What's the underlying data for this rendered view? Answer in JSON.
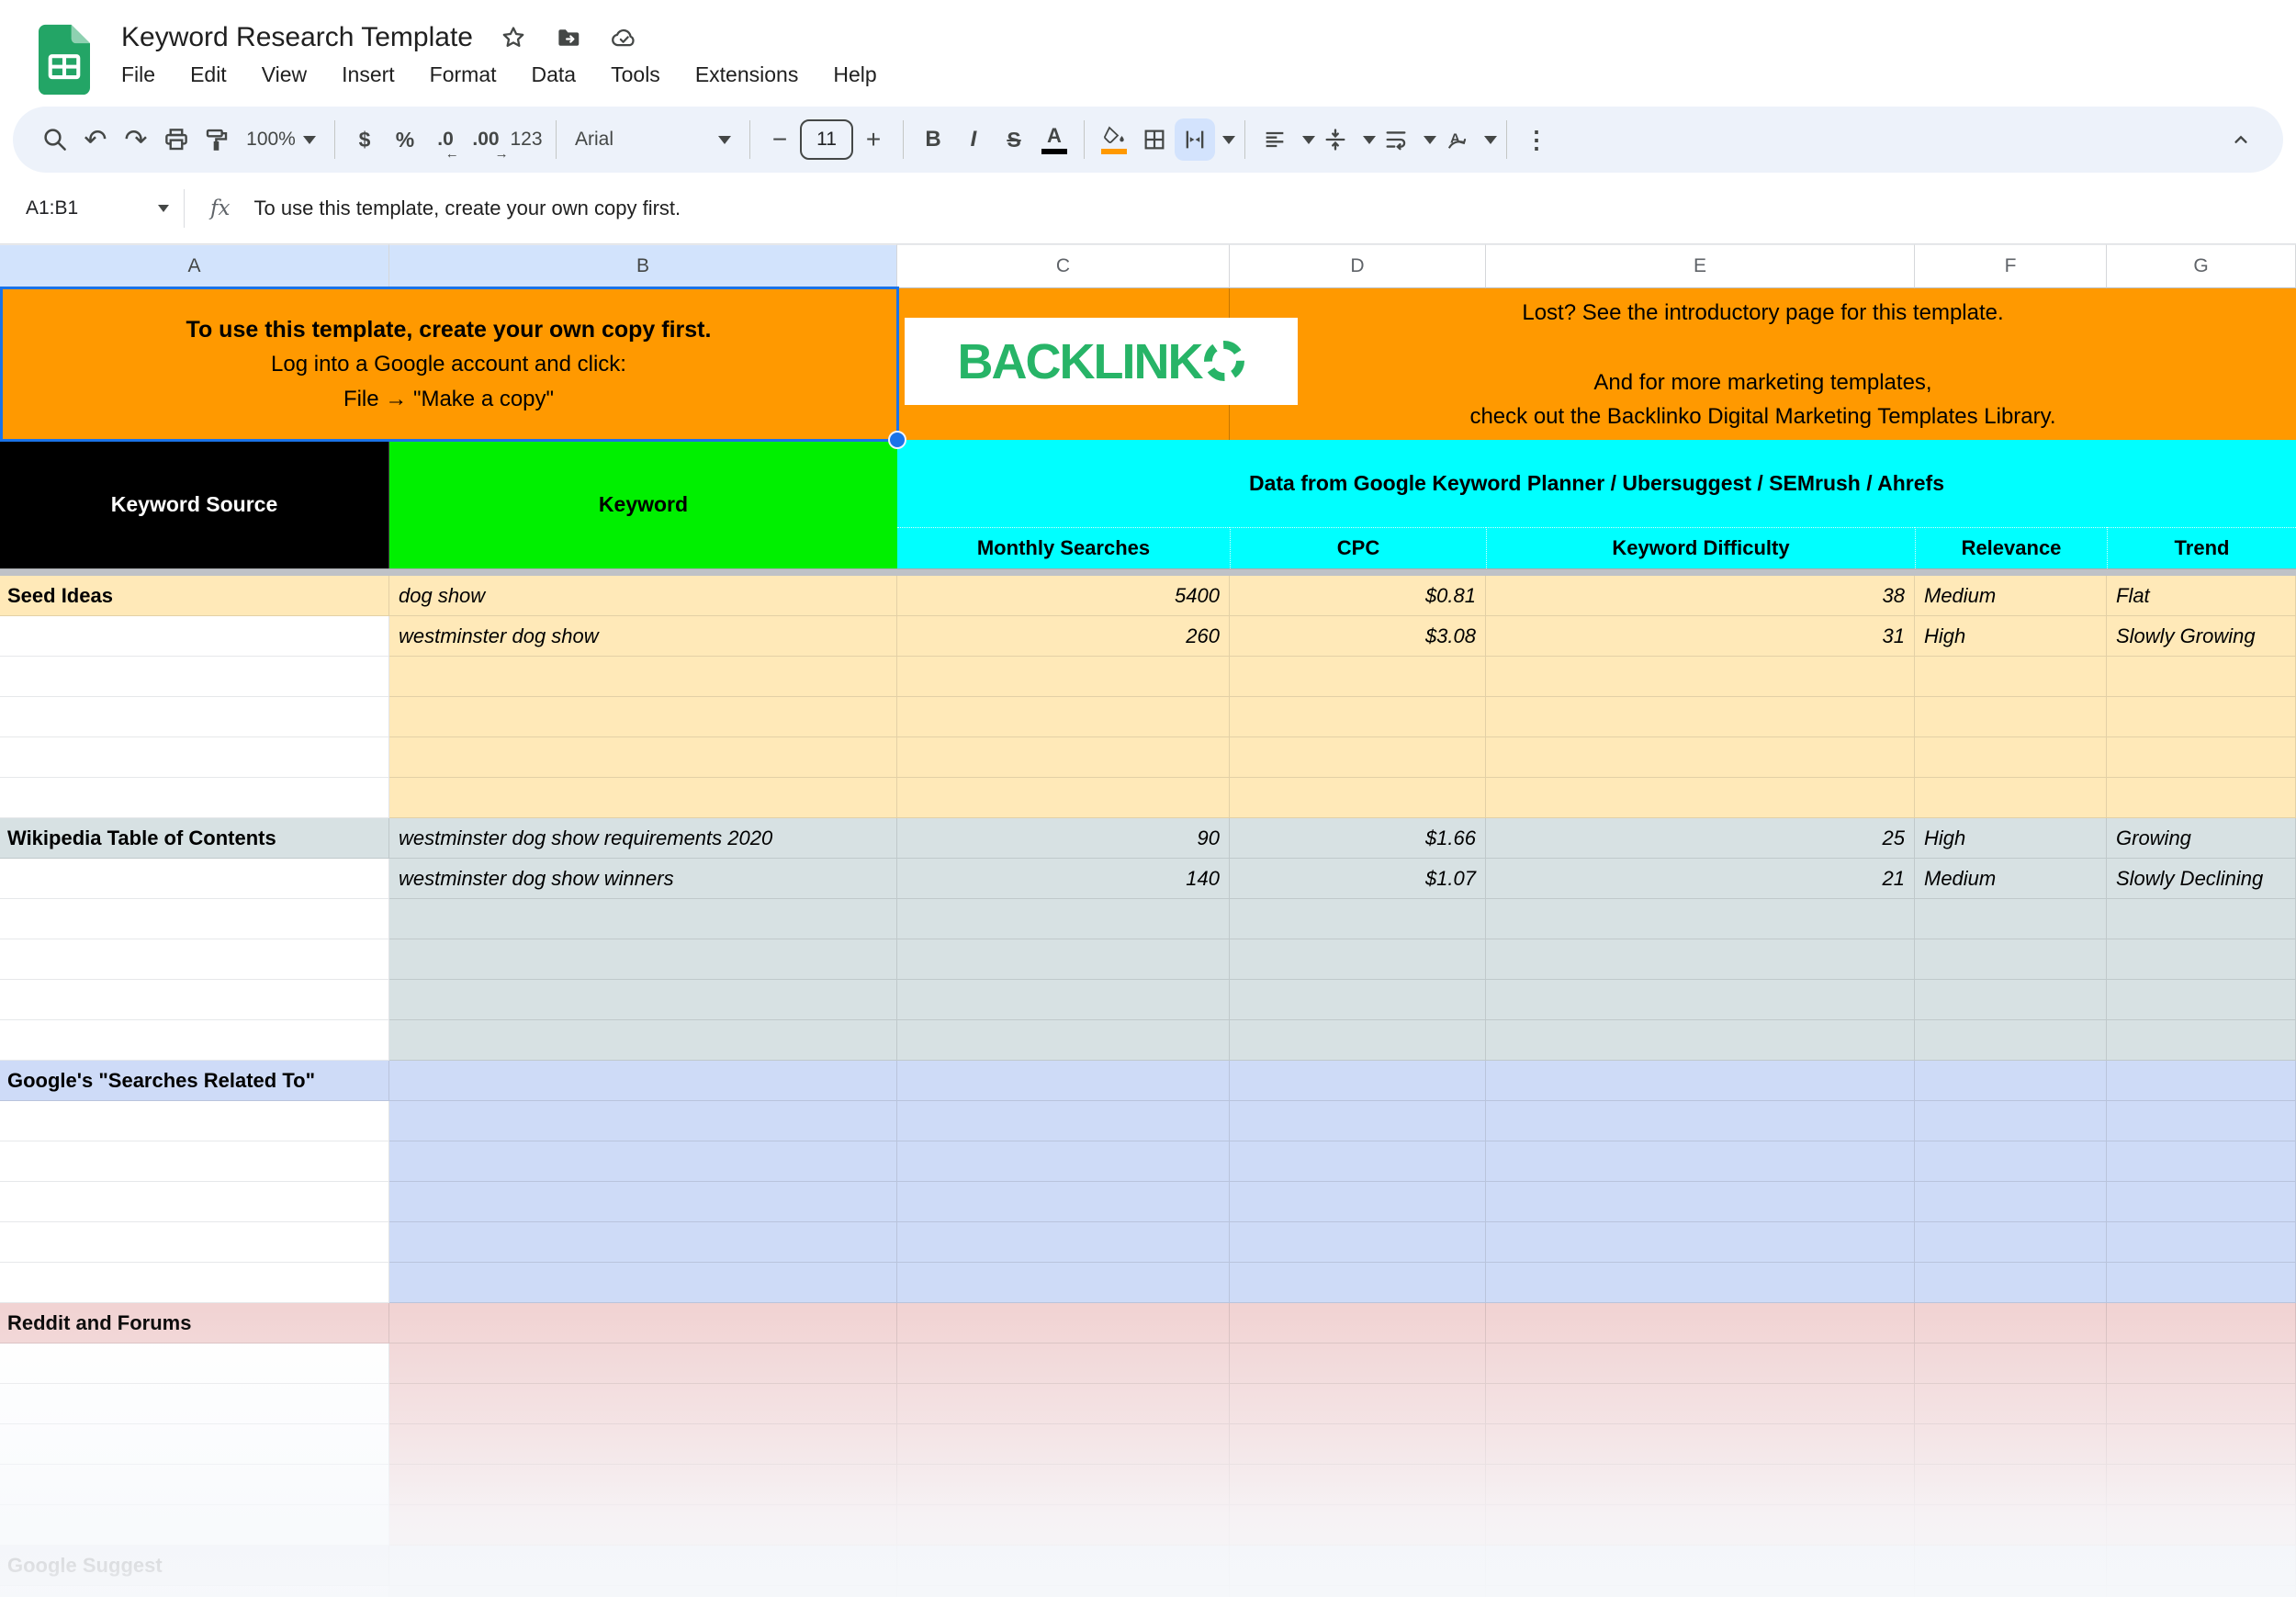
{
  "titlebar": {
    "title": "Keyword Research Template",
    "menus": [
      "File",
      "Edit",
      "View",
      "Insert",
      "Format",
      "Data",
      "Tools",
      "Extensions",
      "Help"
    ]
  },
  "toolbar": {
    "zoom": "100%",
    "currency": "$",
    "percent": "%",
    "decrease_decimals": ".0",
    "increase_decimals": ".00",
    "number_format": "123",
    "font": "Arial",
    "font_size": "11",
    "minus": "−",
    "plus": "+",
    "bold_label": "B",
    "italic_label": "I",
    "strike_label": "S",
    "text_color_label": "A",
    "more_label": "⋮",
    "icons": {
      "search": "magnifier",
      "undo": "↶",
      "redo": "↷",
      "print": "printer",
      "paint_format": "paint-roller",
      "fill_color": "paint-bucket with orange underline",
      "borders": "grid",
      "merge_cells": "inward arrows (active)",
      "horizontal_align": "align-left lines",
      "vertical_align": "arrows to center line",
      "text_wrap": "wrap arrow",
      "text_rotation": "A with arc arrow",
      "hide_menus": "chevron-up"
    },
    "accent_underline_text_color": "#000000",
    "accent_underline_fill_color": "#ff9900",
    "merge_active_bg": "#d3e3fd"
  },
  "formula_bar": {
    "range": "A1:B1",
    "fx_label": "fx",
    "value": "To use this template, create your own copy first."
  },
  "columns": {
    "letters": [
      "A",
      "B",
      "C",
      "D",
      "E",
      "F",
      "G"
    ],
    "selected": [
      "A",
      "B"
    ]
  },
  "banner": {
    "bg": "#ff9900",
    "ab": {
      "line1": "To use this template, create your own copy first.",
      "line2": "Log into a Google account and click:",
      "line3": "File → \"Make a copy\""
    },
    "logo": {
      "text": "BACKLINK",
      "o": "dashed-circle-O",
      "color": "#27b467"
    },
    "right": {
      "line1": "Lost? See the introductory page for this template.",
      "line2": "And for more marketing templates,",
      "line3": "check out the Backlinko Digital Marketing Templates Library."
    }
  },
  "table": {
    "source_header": "Keyword Source",
    "keyword_header": "Keyword",
    "data_header": "Data from Google Keyword Planner / Ubersuggest / SEMrush / Ahrefs",
    "subheaders": [
      "Monthly Searches",
      "CPC",
      "Keyword Difficulty",
      "Relevance",
      "Trend"
    ],
    "header_colors": {
      "source_bg": "#000000",
      "keyword_bg": "#00f000",
      "data_bg": "#00ffff"
    },
    "fills": {
      "seed": "#ffe9b8",
      "wiki": "#d7e1e3",
      "related": "#cedbf7",
      "reddit": "#f1d3d3",
      "suggest": "#e6e8ee"
    },
    "rows": [
      {
        "sec": "seed",
        "a": "Seed Ideas",
        "aFill": true,
        "b": "dog show",
        "c": "5400",
        "d": "$0.81",
        "e": "38",
        "f": "Medium",
        "g": "Flat"
      },
      {
        "sec": "seed",
        "b": "westminster dog show",
        "c": "260",
        "d": "$3.08",
        "e": "31",
        "f": "High",
        "g": "Slowly Growing"
      },
      {
        "sec": "seed"
      },
      {
        "sec": "seed"
      },
      {
        "sec": "seed"
      },
      {
        "sec": "seed"
      },
      {
        "sec": "wiki",
        "a": "Wikipedia Table of Contents",
        "aFill": true,
        "b": "westminster dog show requirements 2020",
        "c": "90",
        "d": "$1.66",
        "e": "25",
        "f": "High",
        "g": "Growing"
      },
      {
        "sec": "wiki",
        "b": "westminster dog show winners",
        "c": "140",
        "d": "$1.07",
        "e": "21",
        "f": "Medium",
        "g": "Slowly Declining"
      },
      {
        "sec": "wiki"
      },
      {
        "sec": "wiki"
      },
      {
        "sec": "wiki"
      },
      {
        "sec": "wiki"
      },
      {
        "sec": "related",
        "a": "Google's \"Searches Related To\"",
        "aFill": true
      },
      {
        "sec": "related"
      },
      {
        "sec": "related"
      },
      {
        "sec": "related"
      },
      {
        "sec": "related"
      },
      {
        "sec": "related"
      },
      {
        "sec": "reddit",
        "a": "Reddit and Forums",
        "aFill": true
      },
      {
        "sec": "reddit"
      },
      {
        "sec": "reddit"
      },
      {
        "sec": "reddit"
      },
      {
        "sec": "reddit"
      },
      {
        "sec": "reddit"
      },
      {
        "sec": "suggest",
        "a": "Google Suggest",
        "aFill": true
      },
      {
        "sec": "suggest"
      }
    ]
  },
  "selection": {
    "range": "A1:B1",
    "border_color": "#1a73e8"
  }
}
